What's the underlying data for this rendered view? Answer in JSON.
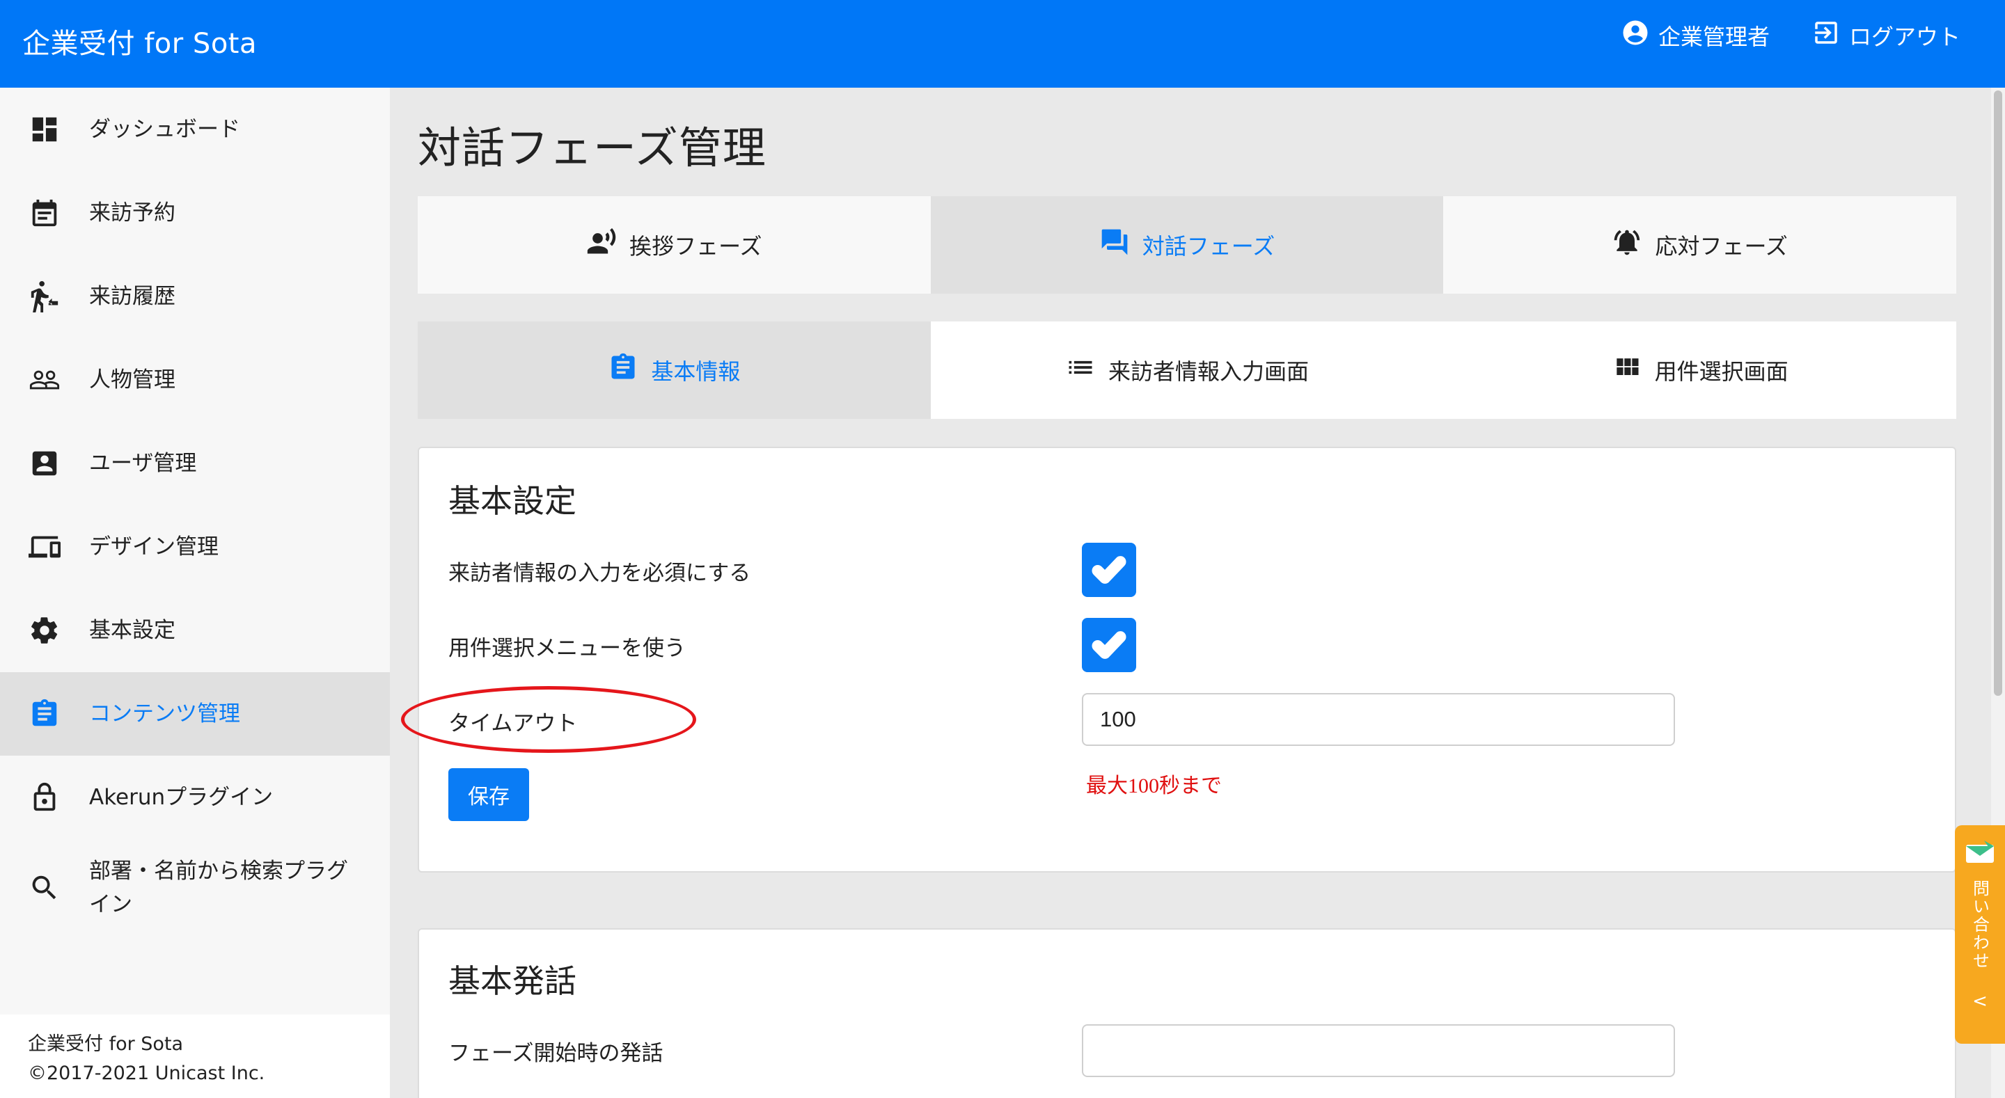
{
  "app": {
    "title": "企業受付 for Sota"
  },
  "header": {
    "user_label": "企業管理者",
    "logout_label": "ログアウト"
  },
  "sidebar": {
    "items": [
      {
        "label": "ダッシュボード",
        "icon": "dashboard-icon"
      },
      {
        "label": "来訪予約",
        "icon": "calendar-icon"
      },
      {
        "label": "来訪履歴",
        "icon": "walk-history-icon"
      },
      {
        "label": "人物管理",
        "icon": "people-icon"
      },
      {
        "label": "ユーザ管理",
        "icon": "user-badge-icon"
      },
      {
        "label": "デザイン管理",
        "icon": "devices-icon"
      },
      {
        "label": "基本設定",
        "icon": "gear-icon"
      },
      {
        "label": "コンテンツ管理",
        "icon": "clipboard-icon",
        "active": true
      },
      {
        "label": "Akerunプラグイン",
        "icon": "lock-icon"
      },
      {
        "label": "部署・名前から検索プラグイン",
        "icon": "search-icon"
      }
    ],
    "footer": {
      "line1": "企業受付 for Sota",
      "line2": "©2017-2021 Unicast Inc."
    }
  },
  "page": {
    "title": "対話フェーズ管理"
  },
  "phase_tabs": [
    {
      "label": "挨拶フェーズ",
      "icon": "person-voice-icon"
    },
    {
      "label": "対話フェーズ",
      "icon": "chat-icon",
      "active": true
    },
    {
      "label": "応対フェーズ",
      "icon": "bell-icon"
    }
  ],
  "sub_tabs": [
    {
      "label": "基本情報",
      "icon": "clipboard-icon",
      "active": true
    },
    {
      "label": "来訪者情報入力画面",
      "icon": "list-icon"
    },
    {
      "label": "用件選択画面",
      "icon": "grid-icon"
    }
  ],
  "basic_settings": {
    "title": "基本設定",
    "require_visitor_info": {
      "label": "来訪者情報の入力を必須にする",
      "checked": true
    },
    "use_purpose_menu": {
      "label": "用件選択メニューを使う",
      "checked": true
    },
    "timeout": {
      "label": "タイムアウト",
      "value": "100",
      "hint": "最大100秒まで"
    },
    "save_label": "保存"
  },
  "basic_speech": {
    "title": "基本発話",
    "phase_start": {
      "label": "フェーズ開始時の発話",
      "value": ""
    }
  },
  "contact_tab": {
    "label": "問い合わせ",
    "chevron": "<"
  },
  "colors": {
    "primary": "#0077f7",
    "accent": "#0a7cf5",
    "hint": "#e01010",
    "contact": "#f7a81f"
  }
}
